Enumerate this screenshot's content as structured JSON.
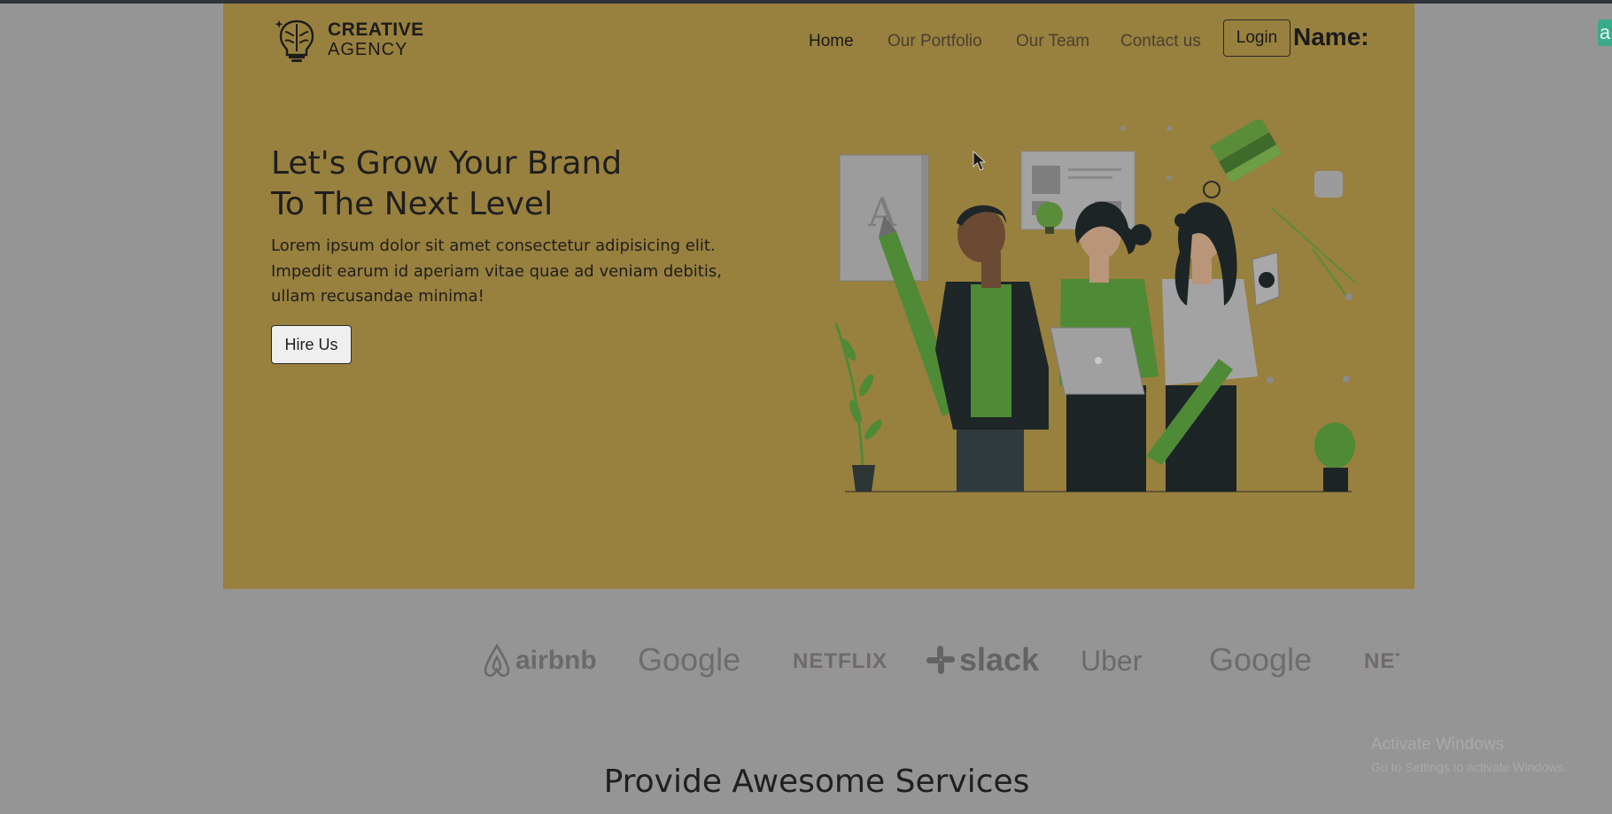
{
  "brand": {
    "line1": "CREATIVE",
    "line2": "AGENCY",
    "icon": "brain-lightbulb-icon"
  },
  "nav": {
    "items": [
      "Home",
      "Our Portfolio",
      "Our Team",
      "Contact us"
    ],
    "active": "Home"
  },
  "header": {
    "login_label": "Login",
    "name_label": "Name:",
    "edge_badge": "a"
  },
  "hero": {
    "title_line1": "Let's Grow Your Brand",
    "title_line2": "To The Next Level",
    "description": "Lorem ipsum dolor sit amet consectetur adipisicing elit. Impedit earum id aperiam vitae quae ad veniam debitis, ullam recusandae minima!",
    "cta_label": "Hire Us"
  },
  "clients": [
    "airbnb",
    "Google",
    "NETFLIX",
    "slack",
    "Uber",
    "Google",
    "NETFLIX"
  ],
  "services": {
    "title": "Provide Awesome Services"
  },
  "watermark": {
    "line1": "Activate Windows",
    "line2": "Go to Settings to activate Windows."
  },
  "colors": {
    "hero_bg": "#98803e",
    "page_overlay": "#959595",
    "accent_green": "#5b8c3a"
  }
}
